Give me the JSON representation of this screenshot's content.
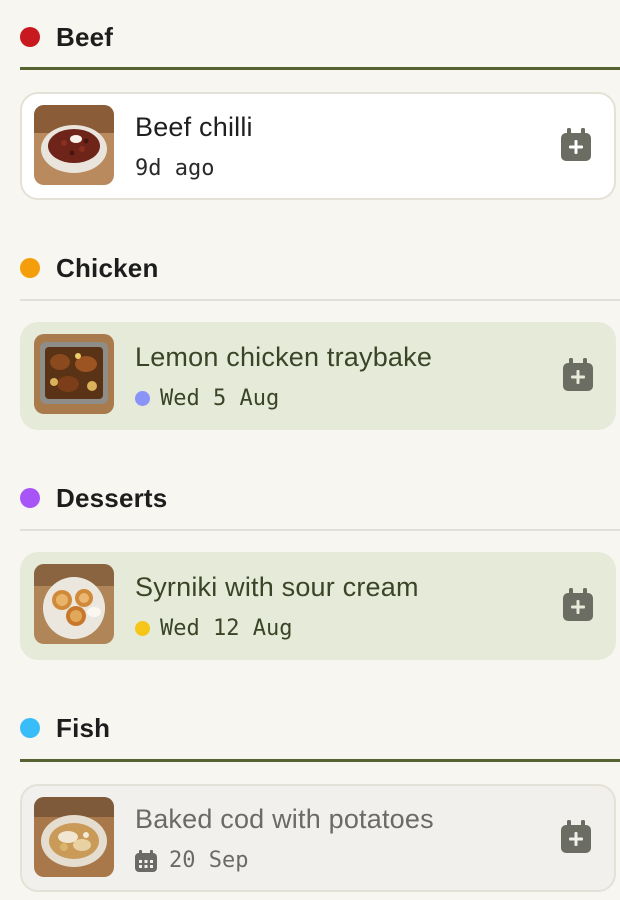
{
  "sections": [
    {
      "title": "Beef",
      "dot_color": "#c8191f",
      "rule": "thick",
      "card": {
        "style": "white",
        "title": "Beef chilli",
        "meta": "9d ago",
        "meta_icon": "none",
        "thumb_icon": "chilli-bowl-photo"
      }
    },
    {
      "title": "Chicken",
      "dot_color": "#f59e0b",
      "rule": "thin",
      "card": {
        "style": "green",
        "title": "Lemon chicken traybake",
        "meta": "Wed 5 Aug",
        "meta_icon": "dot",
        "meta_dot_color": "#8b93f8",
        "thumb_icon": "traybake-photo"
      }
    },
    {
      "title": "Desserts",
      "dot_color": "#a855f7",
      "rule": "thin",
      "card": {
        "style": "green",
        "title": "Syrniki with sour cream",
        "meta": "Wed 12 Aug",
        "meta_icon": "dot",
        "meta_dot_color": "#f5c518",
        "thumb_icon": "syrniki-plate-photo"
      }
    },
    {
      "title": "Fish",
      "dot_color": "#38bdf8",
      "rule": "thick",
      "card": {
        "style": "grey",
        "title": "Baked cod with potatoes",
        "meta": "20 Sep",
        "meta_icon": "calendar",
        "thumb_icon": "baked-cod-photo"
      }
    }
  ],
  "icons": {
    "add_to_calendar": "calendar-plus-icon"
  },
  "colors": {
    "accent": "#566232",
    "icon_grey": "#6b6d62"
  }
}
